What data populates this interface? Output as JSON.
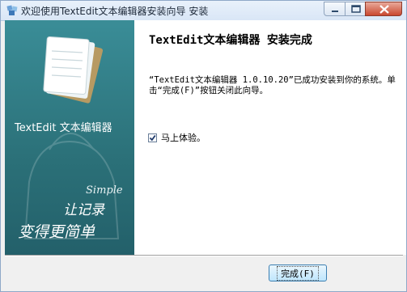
{
  "window": {
    "title": "欢迎使用TextEdit文本编辑器安装向导 安装",
    "controls": {
      "minimize": "minimize-icon",
      "maximize": "maximize-icon",
      "close": "close-icon"
    }
  },
  "sidebar": {
    "product_name": "TextEdit 文本编辑器",
    "artwork": {
      "english_word": "Simple",
      "slogan_line1": "让记录",
      "slogan_line2": "变得更简单"
    }
  },
  "content": {
    "heading": "TextEdit文本编辑器 安装完成",
    "message": "“TextEdit文本编辑器 1.0.10.20”已成功安装到你的系统。单击“完成(F)”按钮关闭此向导。",
    "checkbox": {
      "label": "马上体验。",
      "checked": true
    }
  },
  "buttons": {
    "finish": "完成(F)"
  },
  "colors": {
    "sidebar_top": "#3a8d97",
    "sidebar_bottom": "#23606a",
    "button_border": "#3c7fb1"
  }
}
